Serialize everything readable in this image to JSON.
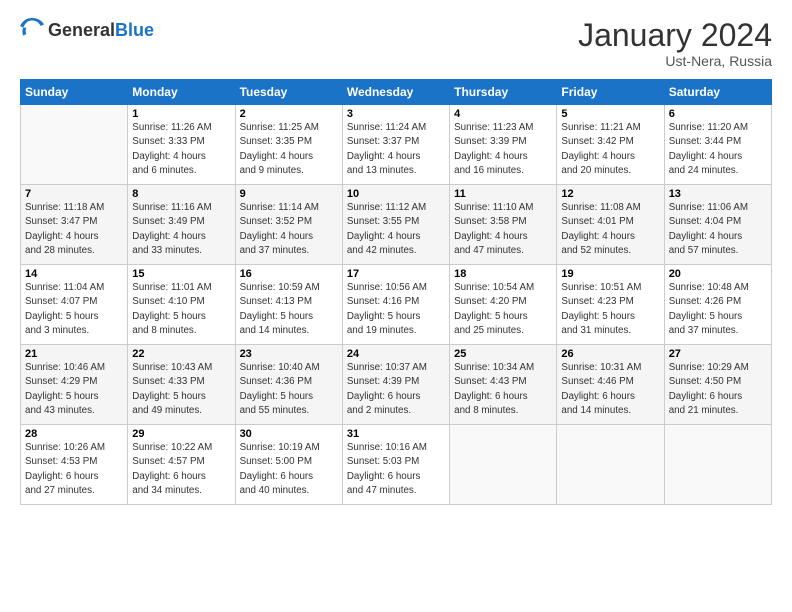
{
  "header": {
    "logo_general": "General",
    "logo_blue": "Blue",
    "month": "January 2024",
    "location": "Ust-Nera, Russia"
  },
  "days_of_week": [
    "Sunday",
    "Monday",
    "Tuesday",
    "Wednesday",
    "Thursday",
    "Friday",
    "Saturday"
  ],
  "weeks": [
    [
      {
        "day": "",
        "info": ""
      },
      {
        "day": "1",
        "info": "Sunrise: 11:26 AM\nSunset: 3:33 PM\nDaylight: 4 hours\nand 6 minutes."
      },
      {
        "day": "2",
        "info": "Sunrise: 11:25 AM\nSunset: 3:35 PM\nDaylight: 4 hours\nand 9 minutes."
      },
      {
        "day": "3",
        "info": "Sunrise: 11:24 AM\nSunset: 3:37 PM\nDaylight: 4 hours\nand 13 minutes."
      },
      {
        "day": "4",
        "info": "Sunrise: 11:23 AM\nSunset: 3:39 PM\nDaylight: 4 hours\nand 16 minutes."
      },
      {
        "day": "5",
        "info": "Sunrise: 11:21 AM\nSunset: 3:42 PM\nDaylight: 4 hours\nand 20 minutes."
      },
      {
        "day": "6",
        "info": "Sunrise: 11:20 AM\nSunset: 3:44 PM\nDaylight: 4 hours\nand 24 minutes."
      }
    ],
    [
      {
        "day": "7",
        "info": "Sunrise: 11:18 AM\nSunset: 3:47 PM\nDaylight: 4 hours\nand 28 minutes."
      },
      {
        "day": "8",
        "info": "Sunrise: 11:16 AM\nSunset: 3:49 PM\nDaylight: 4 hours\nand 33 minutes."
      },
      {
        "day": "9",
        "info": "Sunrise: 11:14 AM\nSunset: 3:52 PM\nDaylight: 4 hours\nand 37 minutes."
      },
      {
        "day": "10",
        "info": "Sunrise: 11:12 AM\nSunset: 3:55 PM\nDaylight: 4 hours\nand 42 minutes."
      },
      {
        "day": "11",
        "info": "Sunrise: 11:10 AM\nSunset: 3:58 PM\nDaylight: 4 hours\nand 47 minutes."
      },
      {
        "day": "12",
        "info": "Sunrise: 11:08 AM\nSunset: 4:01 PM\nDaylight: 4 hours\nand 52 minutes."
      },
      {
        "day": "13",
        "info": "Sunrise: 11:06 AM\nSunset: 4:04 PM\nDaylight: 4 hours\nand 57 minutes."
      }
    ],
    [
      {
        "day": "14",
        "info": "Sunrise: 11:04 AM\nSunset: 4:07 PM\nDaylight: 5 hours\nand 3 minutes."
      },
      {
        "day": "15",
        "info": "Sunrise: 11:01 AM\nSunset: 4:10 PM\nDaylight: 5 hours\nand 8 minutes."
      },
      {
        "day": "16",
        "info": "Sunrise: 10:59 AM\nSunset: 4:13 PM\nDaylight: 5 hours\nand 14 minutes."
      },
      {
        "day": "17",
        "info": "Sunrise: 10:56 AM\nSunset: 4:16 PM\nDaylight: 5 hours\nand 19 minutes."
      },
      {
        "day": "18",
        "info": "Sunrise: 10:54 AM\nSunset: 4:20 PM\nDaylight: 5 hours\nand 25 minutes."
      },
      {
        "day": "19",
        "info": "Sunrise: 10:51 AM\nSunset: 4:23 PM\nDaylight: 5 hours\nand 31 minutes."
      },
      {
        "day": "20",
        "info": "Sunrise: 10:48 AM\nSunset: 4:26 PM\nDaylight: 5 hours\nand 37 minutes."
      }
    ],
    [
      {
        "day": "21",
        "info": "Sunrise: 10:46 AM\nSunset: 4:29 PM\nDaylight: 5 hours\nand 43 minutes."
      },
      {
        "day": "22",
        "info": "Sunrise: 10:43 AM\nSunset: 4:33 PM\nDaylight: 5 hours\nand 49 minutes."
      },
      {
        "day": "23",
        "info": "Sunrise: 10:40 AM\nSunset: 4:36 PM\nDaylight: 5 hours\nand 55 minutes."
      },
      {
        "day": "24",
        "info": "Sunrise: 10:37 AM\nSunset: 4:39 PM\nDaylight: 6 hours\nand 2 minutes."
      },
      {
        "day": "25",
        "info": "Sunrise: 10:34 AM\nSunset: 4:43 PM\nDaylight: 6 hours\nand 8 minutes."
      },
      {
        "day": "26",
        "info": "Sunrise: 10:31 AM\nSunset: 4:46 PM\nDaylight: 6 hours\nand 14 minutes."
      },
      {
        "day": "27",
        "info": "Sunrise: 10:29 AM\nSunset: 4:50 PM\nDaylight: 6 hours\nand 21 minutes."
      }
    ],
    [
      {
        "day": "28",
        "info": "Sunrise: 10:26 AM\nSunset: 4:53 PM\nDaylight: 6 hours\nand 27 minutes."
      },
      {
        "day": "29",
        "info": "Sunrise: 10:22 AM\nSunset: 4:57 PM\nDaylight: 6 hours\nand 34 minutes."
      },
      {
        "day": "30",
        "info": "Sunrise: 10:19 AM\nSunset: 5:00 PM\nDaylight: 6 hours\nand 40 minutes."
      },
      {
        "day": "31",
        "info": "Sunrise: 10:16 AM\nSunset: 5:03 PM\nDaylight: 6 hours\nand 47 minutes."
      },
      {
        "day": "",
        "info": ""
      },
      {
        "day": "",
        "info": ""
      },
      {
        "day": "",
        "info": ""
      }
    ]
  ]
}
